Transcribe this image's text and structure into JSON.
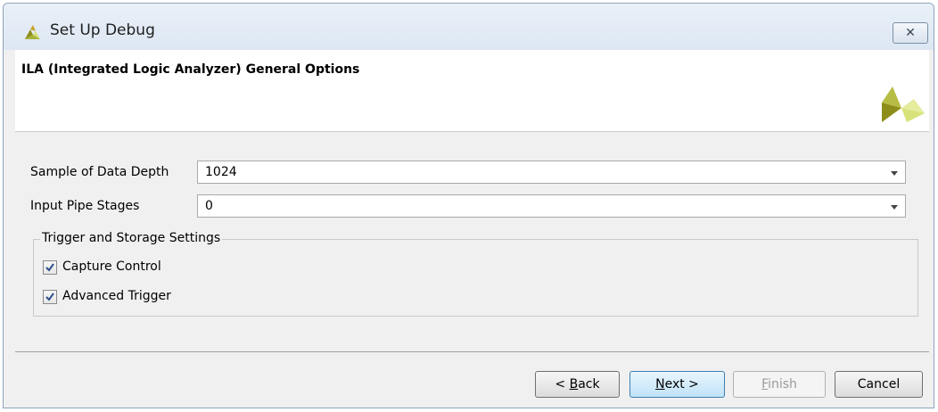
{
  "window": {
    "title": "Set Up Debug",
    "close_glyph": "✕",
    "title_icon": "xilinx-logo-icon"
  },
  "header": {
    "title": "ILA (Integrated Logic Analyzer) General Options",
    "logo": "xilinx-logo"
  },
  "fields": {
    "data_depth": {
      "label": "Sample of Data Depth",
      "value": "1024"
    },
    "pipe_stages": {
      "label": "Input Pipe Stages",
      "value": "0"
    }
  },
  "trigger_group": {
    "legend": "Trigger and Storage Settings",
    "capture_control": {
      "label": "Capture Control",
      "checked": true
    },
    "advanced_trigger": {
      "label": "Advanced Trigger",
      "checked": true
    }
  },
  "buttons": {
    "back": {
      "prefix": "< ",
      "mnemonic": "B",
      "rest": "ack"
    },
    "next": {
      "mnemonic": "N",
      "rest": "ext >"
    },
    "finish": {
      "mnemonic": "F",
      "rest": "inish",
      "enabled": false
    },
    "cancel": {
      "label": "Cancel"
    }
  },
  "colors": {
    "logo_dark": "#8d8d1a",
    "logo_light": "#d8e27a",
    "primary_button": "#bfe2f8"
  }
}
